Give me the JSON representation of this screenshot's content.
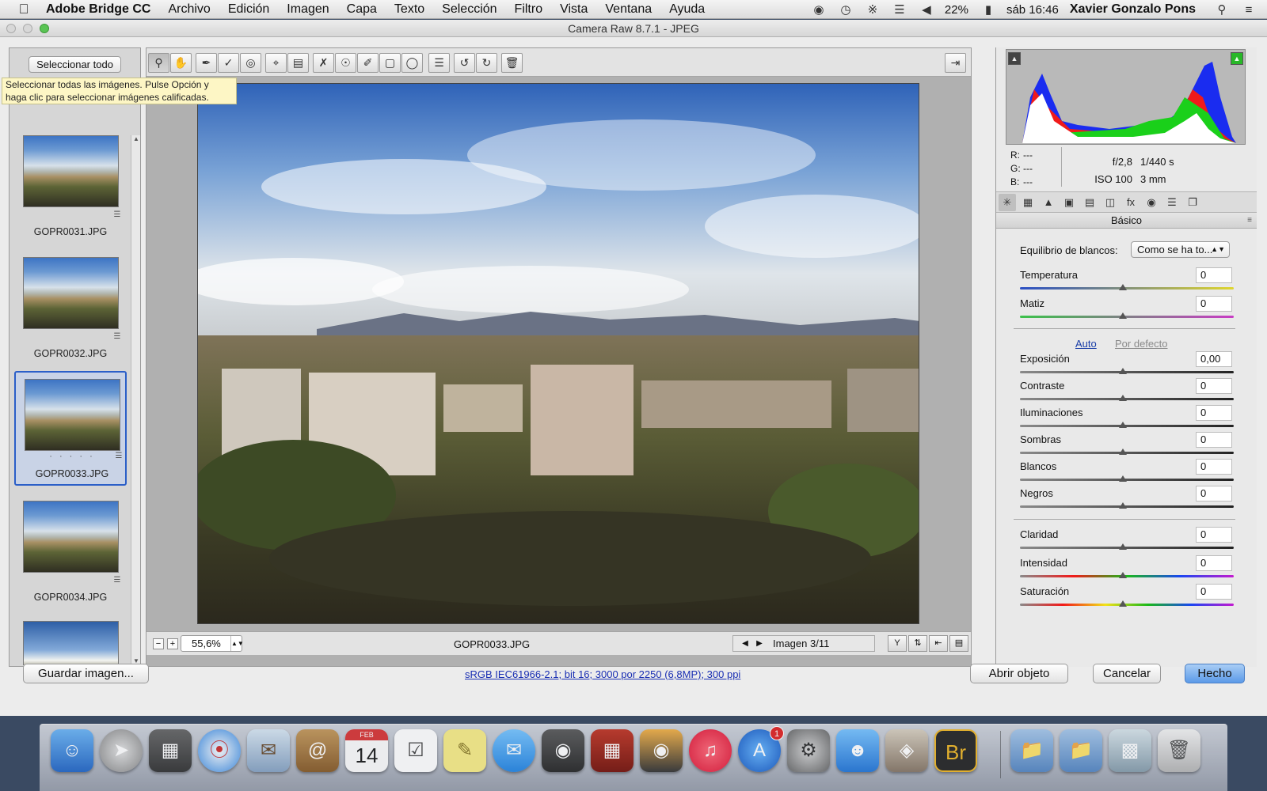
{
  "menubar": {
    "app_name": "Adobe Bridge CC",
    "menus": [
      "Archivo",
      "Edición",
      "Imagen",
      "Capa",
      "Texto",
      "Selección",
      "Filtro",
      "Vista",
      "Ventana",
      "Ayuda"
    ],
    "battery": "22%",
    "clock": "sáb 16:46",
    "user": "Xavier Gonzalo Pons"
  },
  "window": {
    "title": "Camera Raw 8.7.1 -  JPEG"
  },
  "filmstrip": {
    "select_all_label": "Seleccionar todo",
    "tooltip_line1": "Seleccionar todas las imágenes. Pulse Opción y",
    "tooltip_line2": "haga clic para seleccionar imágenes calificadas.",
    "items": [
      {
        "name": "GOPR0031.JPG"
      },
      {
        "name": "GOPR0032.JPG"
      },
      {
        "name": "GOPR0033.JPG",
        "rating_dots": "· · · · ·"
      },
      {
        "name": "GOPR0034.JPG"
      },
      {
        "name": ""
      }
    ]
  },
  "toolbar": {
    "tools": [
      "zoom-icon",
      "hand-icon",
      "white-balance-icon",
      "color-sampler-icon",
      "targeted-adjustment-icon",
      "crop-icon",
      "straighten-icon",
      "spot-removal-icon",
      "red-eye-icon",
      "adjustment-brush-icon",
      "graduated-filter-icon",
      "radial-filter-icon",
      "preferences-icon",
      "rotate-left-icon",
      "rotate-right-icon",
      "trash-icon"
    ]
  },
  "bottombar": {
    "zoom_value": "55,6%",
    "filename": "GOPR0033.JPG",
    "image_counter": "Imagen 3/11"
  },
  "histogram": {
    "r_label": "R:",
    "r_value": "---",
    "g_label": "G:",
    "g_value": "---",
    "b_label": "B:",
    "b_value": "---",
    "aperture": "f/2,8",
    "shutter": "1/440 s",
    "iso": "ISO 100",
    "focal": "3 mm"
  },
  "basic_panel": {
    "section_title": "Básico",
    "wb_label": "Equilibrio de blancos:",
    "wb_value": "Como se ha to...",
    "auto_label": "Auto",
    "default_label": "Por defecto",
    "sliders": [
      {
        "label": "Temperatura",
        "value": "0"
      },
      {
        "label": "Matiz",
        "value": "0"
      },
      {
        "label": "Exposición",
        "value": "0,00"
      },
      {
        "label": "Contraste",
        "value": "0"
      },
      {
        "label": "Iluminaciones",
        "value": "0"
      },
      {
        "label": "Sombras",
        "value": "0"
      },
      {
        "label": "Blancos",
        "value": "0"
      },
      {
        "label": "Negros",
        "value": "0"
      },
      {
        "label": "Claridad",
        "value": "0"
      },
      {
        "label": "Intensidad",
        "value": "0"
      },
      {
        "label": "Saturación",
        "value": "0"
      }
    ]
  },
  "footer": {
    "save_label": "Guardar imagen...",
    "info_link": "sRGB IEC61966-2.1; bit 16; 3000 por 2250 (6,8MP); 300 ppi",
    "open_object_label": "Abrir objeto",
    "cancel_label": "Cancelar",
    "done_label": "Hecho"
  },
  "dock": {
    "calendar_month": "FEB",
    "calendar_day": "14",
    "appstore_badge": "1",
    "bridge_label": "Br"
  },
  "colors": {
    "accent": "#2b5fc8",
    "done_button": "#5b9ae8",
    "link": "#1a3ea8"
  }
}
